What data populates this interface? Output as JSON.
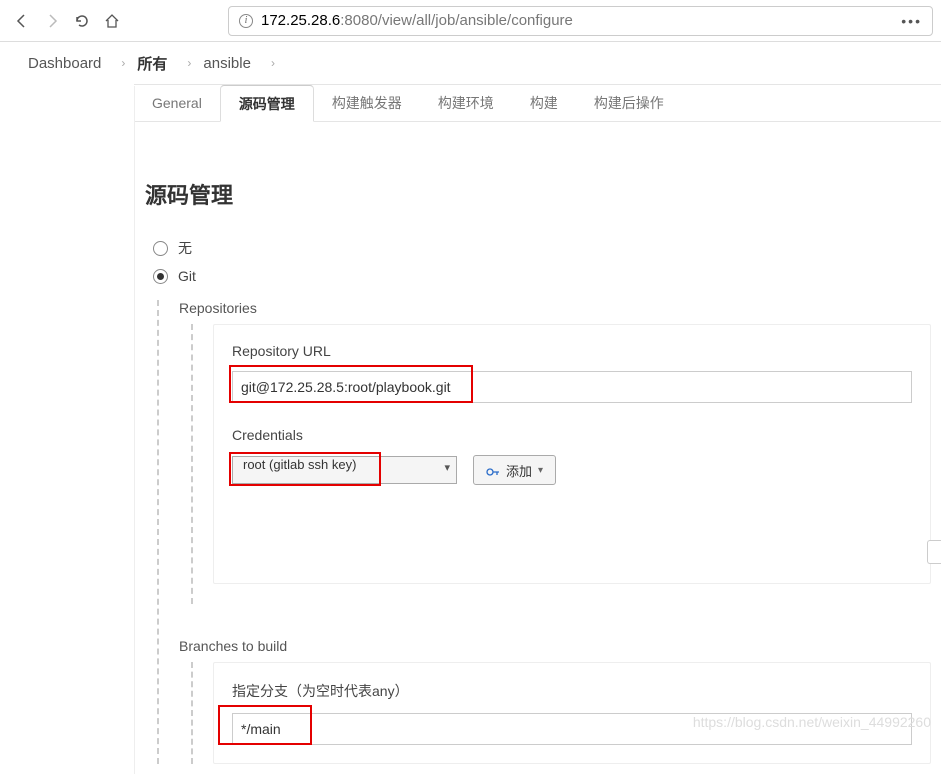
{
  "browser": {
    "url_host": "172.25.28.6",
    "url_port_path": ":8080/view/all/job/ansible/configure",
    "dots": "•••"
  },
  "breadcrumb": {
    "items": [
      "Dashboard",
      "所有",
      "ansible"
    ]
  },
  "tabs": {
    "items": [
      "General",
      "源码管理",
      "构建触发器",
      "构建环境",
      "构建",
      "构建后操作"
    ],
    "active_index": 1
  },
  "scm": {
    "title": "源码管理",
    "none_label": "无",
    "git_label": "Git",
    "repositories_label": "Repositories",
    "repo_url_label": "Repository URL",
    "repo_url_value": "git@172.25.28.5:root/playbook.git",
    "credentials_label": "Credentials",
    "credentials_value": "root (gitlab ssh key)",
    "add_button_label": "添加",
    "branches_label": "Branches to build",
    "branch_spec_label": "指定分支（为空时代表any）",
    "branch_spec_value": "*/main"
  },
  "watermark": "https://blog.csdn.net/weixin_44992260"
}
